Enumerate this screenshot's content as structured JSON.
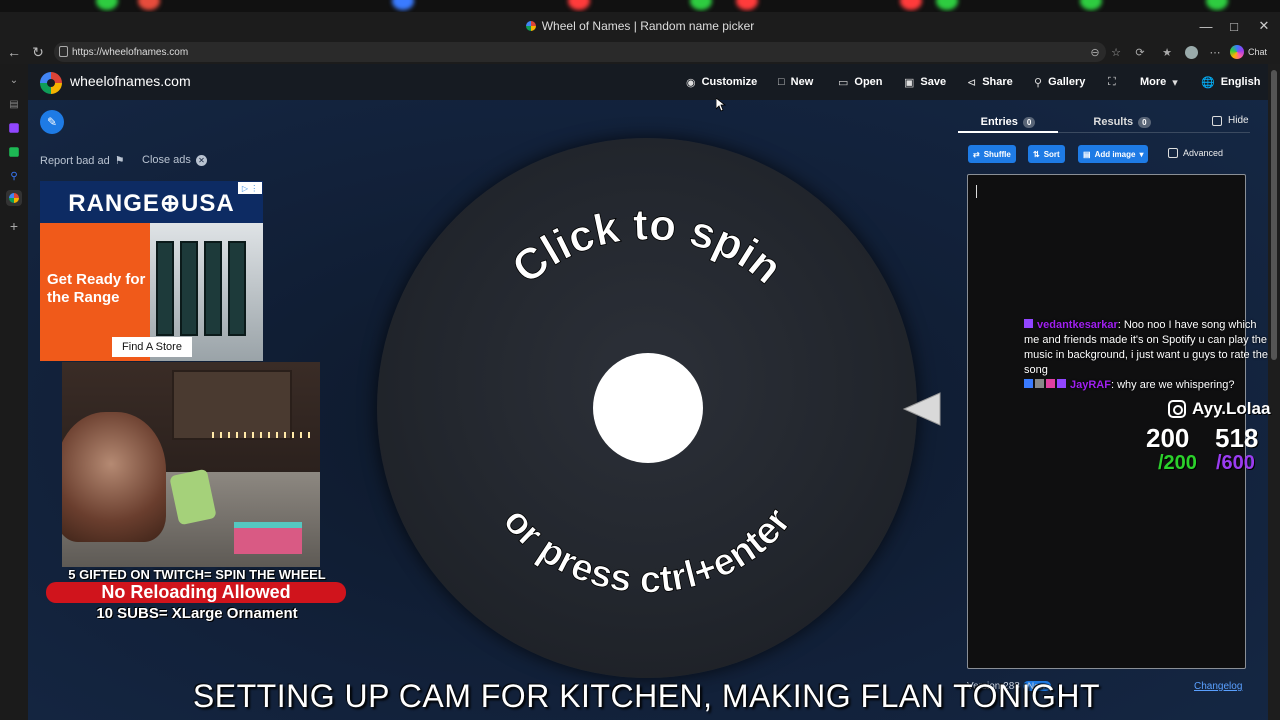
{
  "browser": {
    "window_title": "Wheel of Names | Random name picker",
    "url": "https://wheelofnames.com",
    "copilot_label": "Chat"
  },
  "app": {
    "site_name": "wheelofnames.com",
    "menu": [
      {
        "label": "Customize",
        "icon": "palette-icon"
      },
      {
        "label": "New",
        "icon": "file-icon"
      },
      {
        "label": "Open",
        "icon": "folder-icon"
      },
      {
        "label": "Save",
        "icon": "floppy-icon"
      },
      {
        "label": "Share",
        "icon": "share-icon"
      },
      {
        "label": "Gallery",
        "icon": "search-icon"
      },
      {
        "label": "",
        "icon": "fullscreen-icon"
      },
      {
        "label": "More",
        "icon": "chevron-down-icon"
      },
      {
        "label": "English",
        "icon": "globe-icon"
      }
    ]
  },
  "ads": {
    "report_label": "Report bad ad",
    "close_label": "Close ads",
    "brand": "RANGE⊕USA",
    "tagline": "Get Ready for the Range",
    "button": "Find A Store"
  },
  "wheel": {
    "top_text": "Click to spin",
    "bottom_text": "or press ctrl+enter"
  },
  "panel": {
    "tabs": [
      {
        "label": "Entries",
        "count": "0"
      },
      {
        "label": "Results",
        "count": "0"
      }
    ],
    "hide_label": "Hide",
    "toolbar": {
      "shuffle": "Shuffle",
      "sort": "Sort",
      "add_image": "Add image",
      "advanced": "Advanced"
    },
    "version": "Version 288",
    "version_badge": "New",
    "changelog": "Changelog"
  },
  "stream_overlay": {
    "promo_line1": "5 GIFTED ON TWITCH= SPIN THE WHEEL",
    "promo_line2": "No Reloading Allowed",
    "promo_line3": "10 SUBS= XLarge Ornament",
    "chat": [
      {
        "user": "vedantkesarkar",
        "message": ": Noo noo I have song which me and friends made it's on Spotify u can play the music in background, i just want u guys to rate the song"
      },
      {
        "user": "JayRAF",
        "message": ": why are we whispering?"
      }
    ],
    "instagram": "Ayy.Lolaa",
    "goal_left": "200",
    "goal_left_total": "/200",
    "goal_right": "518",
    "goal_right_total": "/600",
    "caption": "SETTING UP CAM FOR KITCHEN, MAKING FLAN TONIGHT"
  },
  "colors": {
    "accent": "#1e7be5",
    "page_bg": "#12213a",
    "chat_user": "#a020f0",
    "goal_green": "#2bd12b",
    "goal_purple": "#9a3cf0"
  }
}
